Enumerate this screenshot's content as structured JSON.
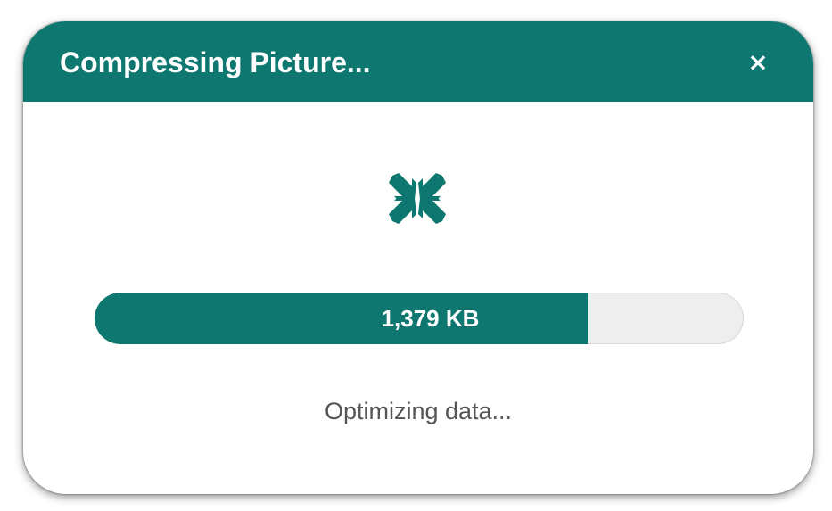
{
  "dialog": {
    "title": "Compressing Picture...",
    "close_label": "×",
    "icon": "compress-arrows-icon",
    "progress": {
      "label": "1,379 KB",
      "fraction": 0.76
    },
    "status": "Optimizing data..."
  },
  "colors": {
    "accent": "#0d7770",
    "track": "#eeeeee",
    "status_text": "#555555"
  }
}
